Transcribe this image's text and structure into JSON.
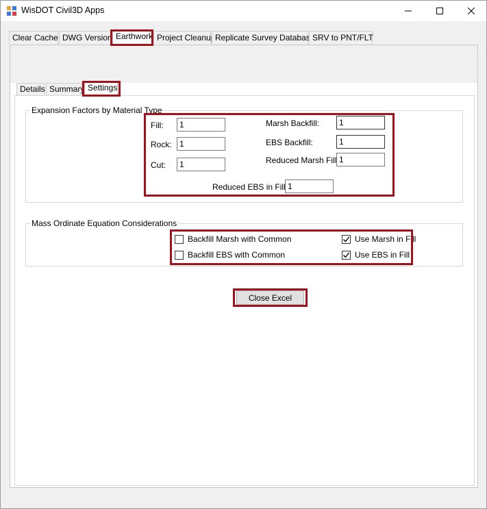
{
  "window": {
    "title": "WisDOT Civil3D Apps"
  },
  "outer_tabs": [
    {
      "label": "Clear Cache"
    },
    {
      "label": "DWG Version"
    },
    {
      "label": "Earthwork"
    },
    {
      "label": "Project Cleanup"
    },
    {
      "label": "Replicate Survey Database"
    },
    {
      "label": "SRV to PNT/FLT"
    }
  ],
  "inner_tabs": [
    {
      "label": "Details"
    },
    {
      "label": "Summary"
    },
    {
      "label": "Settings"
    }
  ],
  "expansion": {
    "title": "Expansion Factors by Material Type",
    "fill_label": "Fill:",
    "fill_value": "1",
    "rock_label": "Rock:",
    "rock_value": "1",
    "cut_label": "Cut:",
    "cut_value": "1",
    "marsh_label": "Marsh Backfill:",
    "marsh_value": "1",
    "ebs_label": "EBS Backfill:",
    "ebs_value": "1",
    "reduced_marsh_label": "Reduced Marsh Fill:",
    "reduced_marsh_value": "1",
    "reduced_ebs_label": "Reduced EBS in Fill:",
    "reduced_ebs_value": "1"
  },
  "mass_ordinate": {
    "title": "Mass Ordinate Equation Considerations",
    "backfill_marsh": {
      "label": "Backfill Marsh with Common",
      "checked": false
    },
    "backfill_ebs": {
      "label": "Backfill EBS with Common",
      "checked": false
    },
    "use_marsh": {
      "label": "Use Marsh in Fill",
      "checked": true
    },
    "use_ebs": {
      "label": "Use EBS in Fill",
      "checked": true
    }
  },
  "close_button": "Close Excel",
  "colors": {
    "highlight": "#a0121e"
  },
  "icons": [
    "app-icon",
    "minimize-icon",
    "maximize-icon",
    "close-icon",
    "checkmark-icon"
  ]
}
